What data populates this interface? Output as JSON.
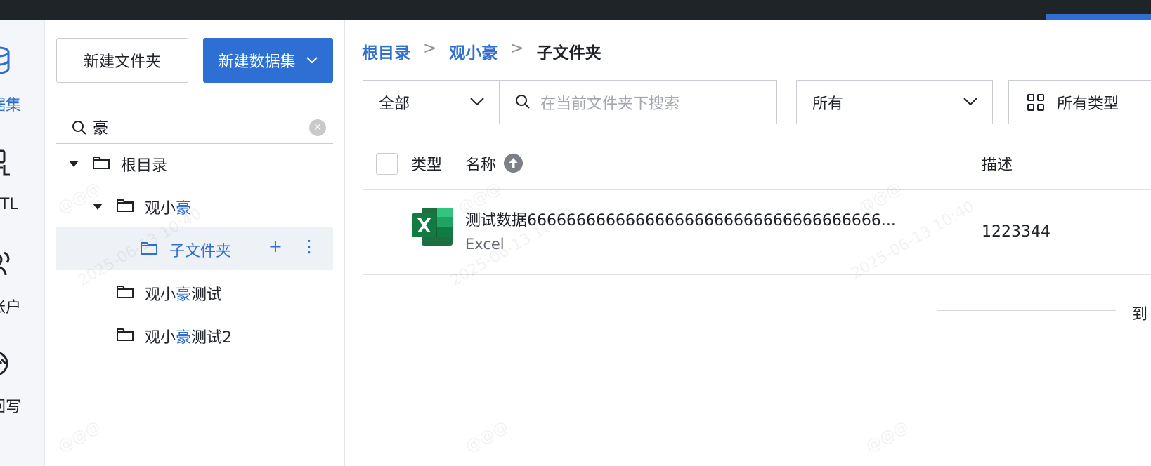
{
  "sidebar_nav": [
    {
      "label": "据集",
      "icon": "database-icon",
      "active": true
    },
    {
      "label": "ETL",
      "icon": "etl-icon",
      "active": false
    },
    {
      "label": "账户",
      "icon": "account-icon",
      "active": false
    },
    {
      "label": "回写",
      "icon": "writeback-icon",
      "active": false
    }
  ],
  "toolbar": {
    "new_folder_label": "新建文件夹",
    "new_dataset_label": "新建数据集"
  },
  "tree_search": {
    "value": "豪"
  },
  "tree": {
    "root": {
      "label": "根目录"
    },
    "items": [
      {
        "prefix": "观小",
        "match": "豪",
        "suffix": ""
      },
      {
        "prefix": "",
        "match": "",
        "suffix": "子文件夹"
      },
      {
        "prefix": "观小",
        "match": "豪",
        "suffix": "测试"
      },
      {
        "prefix": "观小",
        "match": "豪",
        "suffix": "测试2"
      }
    ],
    "selected_index": 1,
    "add_symbol": "+",
    "more_symbol": "⋮"
  },
  "breadcrumb": {
    "items": [
      "根目录",
      "观小豪"
    ],
    "separator": ">",
    "current": "子文件夹"
  },
  "filters": {
    "scope_value": "全部",
    "search_placeholder": "在当前文件夹下搜索",
    "owner_value": "所有",
    "type_value": "所有类型"
  },
  "table": {
    "columns": {
      "type": "类型",
      "name": "名称",
      "description": "描述"
    },
    "rows": [
      {
        "name": "测试数据666666666666666666666666666666666666...",
        "type": "Excel",
        "description": "1223344"
      }
    ]
  },
  "pager": {
    "text": "到"
  },
  "watermarks": [
    "@@@",
    "2025-06-13 10:40"
  ],
  "colors": {
    "accent": "#2f6fd0",
    "topbar": "#1f2428",
    "excel": "#1d6f42"
  }
}
